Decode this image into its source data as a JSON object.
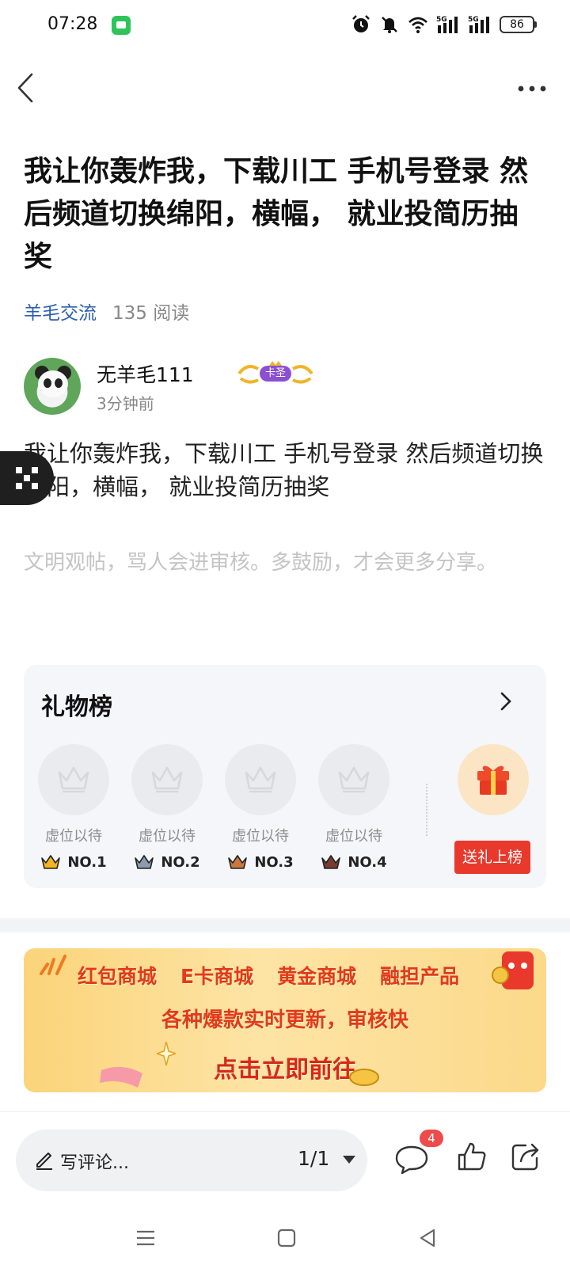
{
  "status_bar": {
    "time": "07:28",
    "battery": "86",
    "icons": [
      "message-app-icon",
      "alarm-icon",
      "mute-icon",
      "wifi-icon",
      "5g-signal-icon",
      "5g-signal-icon"
    ]
  },
  "nav": {
    "back_icon": "back-icon",
    "more_icon": "more-icon"
  },
  "post": {
    "title": "我让你轰炸我，下载川工 手机号登录 然后频道切换绵阳，横幅， 就业投简历抽奖",
    "channel": "羊毛交流",
    "reads": "135 阅读",
    "author": {
      "name": "无羊毛111",
      "badge": "卡圣",
      "time": "3分钟前"
    },
    "body": "我让你轰炸我，下载川工 手机号登录 然后频道切换绵阳，横幅， 就业投简历抽奖",
    "civil_note": "文明观帖，骂人会进审核。多鼓励，才会更多分享。"
  },
  "gift_board": {
    "title": "礼物榜",
    "slots": [
      {
        "label": "虚位以待",
        "rank": "NO.1",
        "color": "#f2b51d"
      },
      {
        "label": "虚位以待",
        "rank": "NO.2",
        "color": "#8e9aad"
      },
      {
        "label": "虚位以待",
        "rank": "NO.3",
        "color": "#c9793f"
      },
      {
        "label": "虚位以待",
        "rank": "NO.4",
        "color": "#7a3b32"
      }
    ],
    "send_button": "送礼上榜"
  },
  "promo": {
    "items": [
      "红包商城",
      "E卡商城",
      "黄金商城",
      "融担产品"
    ],
    "subtitle": "各种爆款实时更新，审核快",
    "cta": "点击立即前往"
  },
  "bottom_bar": {
    "comment_placeholder": "写评论...",
    "page_indicator": "1/1",
    "comment_count": "4"
  },
  "colors": {
    "accent_blue": "#2a5db0",
    "send_red": "#e8392c",
    "badge_red": "#ee4b4b"
  }
}
